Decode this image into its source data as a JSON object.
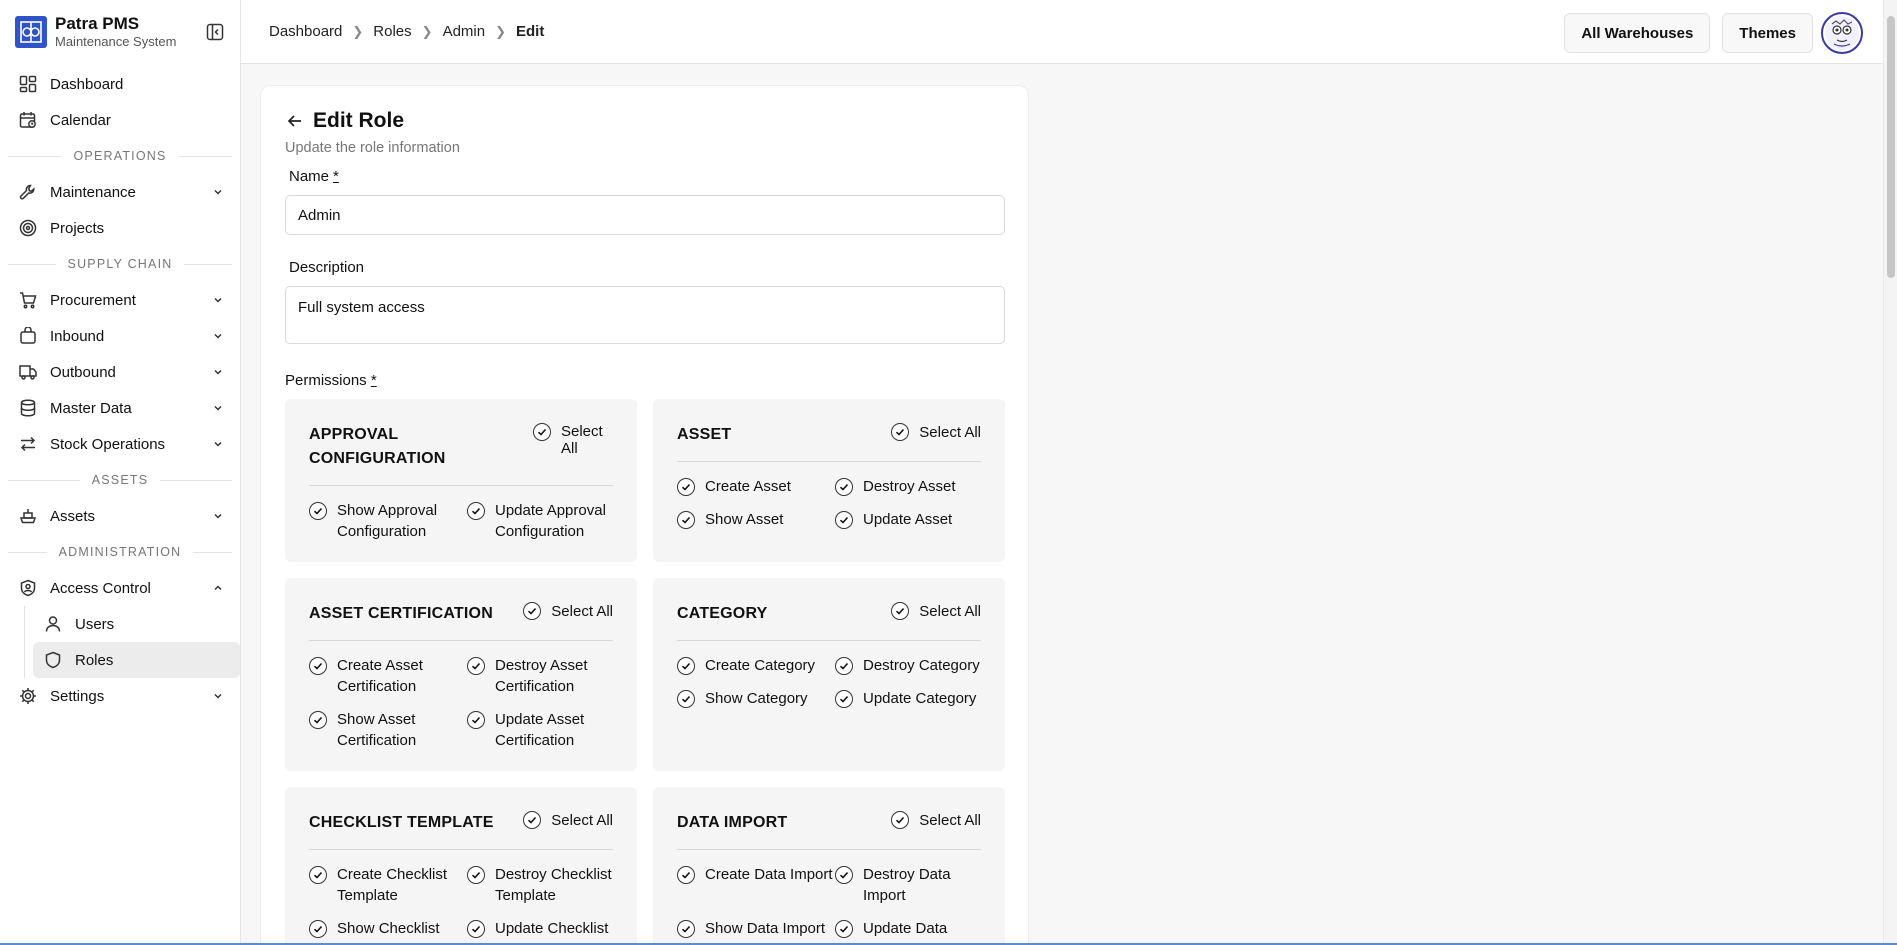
{
  "brand": {
    "name": "Patra PMS",
    "subtitle": "Maintenance System"
  },
  "sidebar": {
    "items_top": [
      {
        "label": "Dashboard",
        "icon": "dashboard-icon"
      },
      {
        "label": "Calendar",
        "icon": "calendar-icon"
      }
    ],
    "sections": {
      "operations": "OPERATIONS",
      "supply_chain": "SUPPLY CHAIN",
      "assets": "ASSETS",
      "administration": "ADMINISTRATION"
    },
    "operations_items": [
      {
        "label": "Maintenance",
        "icon": "wrench-icon",
        "expandable": true
      },
      {
        "label": "Projects",
        "icon": "target-icon",
        "expandable": false
      }
    ],
    "supply_items": [
      {
        "label": "Procurement",
        "icon": "cart-icon"
      },
      {
        "label": "Inbound",
        "icon": "box-icon"
      },
      {
        "label": "Outbound",
        "icon": "truck-icon"
      },
      {
        "label": "Master Data",
        "icon": "database-icon"
      },
      {
        "label": "Stock Operations",
        "icon": "transfer-icon"
      }
    ],
    "assets_items": [
      {
        "label": "Assets",
        "icon": "ship-icon"
      }
    ],
    "admin": {
      "access_control": "Access Control",
      "users": "Users",
      "roles": "Roles",
      "settings": "Settings"
    }
  },
  "breadcrumb": [
    "Dashboard",
    "Roles",
    "Admin",
    "Edit"
  ],
  "header": {
    "warehouses": "All Warehouses",
    "themes": "Themes"
  },
  "form": {
    "title": "Edit Role",
    "subtitle": "Update the role information",
    "name_label": "Name",
    "required_mark": "*",
    "name_value": "Admin",
    "description_label": "Description",
    "description_value": "Full system access",
    "permissions_label": "Permissions",
    "select_all": "Select All"
  },
  "permission_groups": [
    {
      "title": "APPROVAL CONFIGURATION",
      "select_all": "Select All",
      "items": [
        "Show Approval Configuration",
        "Update Approval Configuration"
      ]
    },
    {
      "title": "ASSET",
      "select_all": "Select All",
      "items": [
        "Create Asset",
        "Destroy Asset",
        "Show Asset",
        "Update Asset"
      ]
    },
    {
      "title": "ASSET CERTIFICATION",
      "select_all": "Select All",
      "items": [
        "Create Asset Certification",
        "Destroy Asset Certification",
        "Show Asset Certification",
        "Update Asset Certification"
      ]
    },
    {
      "title": "CATEGORY",
      "select_all": "Select All",
      "items": [
        "Create Category",
        "Destroy Category",
        "Show Category",
        "Update Category"
      ]
    },
    {
      "title": "CHECKLIST TEMPLATE",
      "select_all": "Select All",
      "items": [
        "Create Checklist Template",
        "Destroy Checklist Template",
        "Show Checklist Template",
        "Update Checklist Template"
      ]
    },
    {
      "title": "DATA IMPORT",
      "select_all": "Select All",
      "items": [
        "Create Data Import",
        "Destroy Data Import",
        "Show Data Import",
        "Update Data Import"
      ]
    }
  ],
  "colors": {
    "brand": "#2f54c9",
    "avatar_border": "#3a39a8",
    "active_bg": "#ececec"
  }
}
